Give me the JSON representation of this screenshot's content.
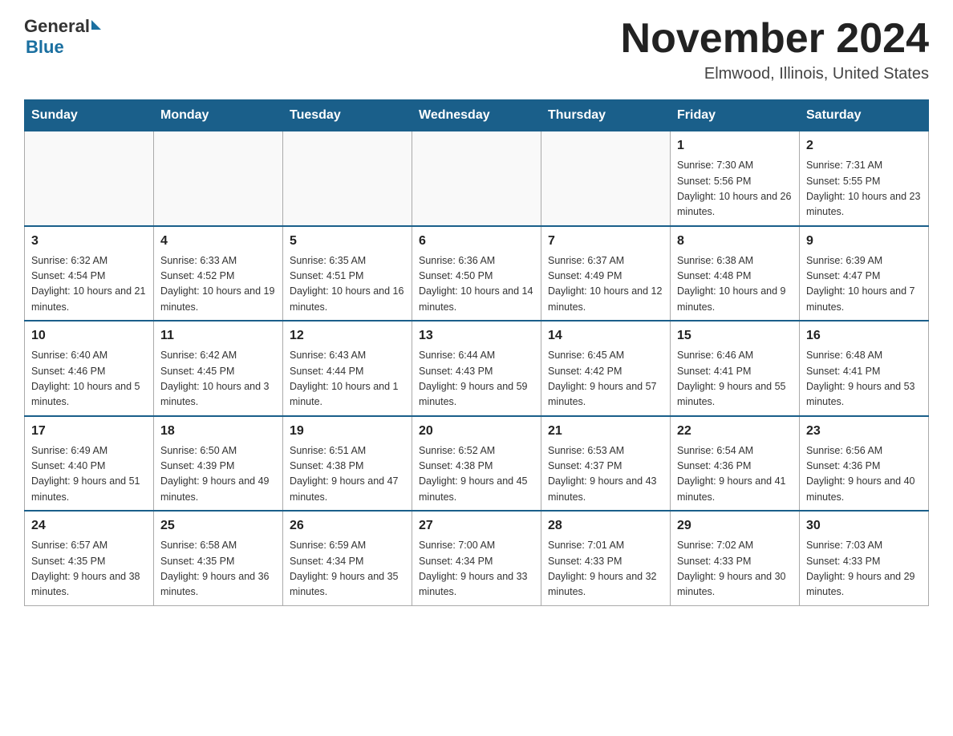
{
  "logo": {
    "general": "General",
    "blue": "Blue",
    "triangle": "▶"
  },
  "title": "November 2024",
  "subtitle": "Elmwood, Illinois, United States",
  "headers": [
    "Sunday",
    "Monday",
    "Tuesday",
    "Wednesday",
    "Thursday",
    "Friday",
    "Saturday"
  ],
  "weeks": [
    [
      {
        "day": "",
        "info": ""
      },
      {
        "day": "",
        "info": ""
      },
      {
        "day": "",
        "info": ""
      },
      {
        "day": "",
        "info": ""
      },
      {
        "day": "",
        "info": ""
      },
      {
        "day": "1",
        "info": "Sunrise: 7:30 AM\nSunset: 5:56 PM\nDaylight: 10 hours and 26 minutes."
      },
      {
        "day": "2",
        "info": "Sunrise: 7:31 AM\nSunset: 5:55 PM\nDaylight: 10 hours and 23 minutes."
      }
    ],
    [
      {
        "day": "3",
        "info": "Sunrise: 6:32 AM\nSunset: 4:54 PM\nDaylight: 10 hours and 21 minutes."
      },
      {
        "day": "4",
        "info": "Sunrise: 6:33 AM\nSunset: 4:52 PM\nDaylight: 10 hours and 19 minutes."
      },
      {
        "day": "5",
        "info": "Sunrise: 6:35 AM\nSunset: 4:51 PM\nDaylight: 10 hours and 16 minutes."
      },
      {
        "day": "6",
        "info": "Sunrise: 6:36 AM\nSunset: 4:50 PM\nDaylight: 10 hours and 14 minutes."
      },
      {
        "day": "7",
        "info": "Sunrise: 6:37 AM\nSunset: 4:49 PM\nDaylight: 10 hours and 12 minutes."
      },
      {
        "day": "8",
        "info": "Sunrise: 6:38 AM\nSunset: 4:48 PM\nDaylight: 10 hours and 9 minutes."
      },
      {
        "day": "9",
        "info": "Sunrise: 6:39 AM\nSunset: 4:47 PM\nDaylight: 10 hours and 7 minutes."
      }
    ],
    [
      {
        "day": "10",
        "info": "Sunrise: 6:40 AM\nSunset: 4:46 PM\nDaylight: 10 hours and 5 minutes."
      },
      {
        "day": "11",
        "info": "Sunrise: 6:42 AM\nSunset: 4:45 PM\nDaylight: 10 hours and 3 minutes."
      },
      {
        "day": "12",
        "info": "Sunrise: 6:43 AM\nSunset: 4:44 PM\nDaylight: 10 hours and 1 minute."
      },
      {
        "day": "13",
        "info": "Sunrise: 6:44 AM\nSunset: 4:43 PM\nDaylight: 9 hours and 59 minutes."
      },
      {
        "day": "14",
        "info": "Sunrise: 6:45 AM\nSunset: 4:42 PM\nDaylight: 9 hours and 57 minutes."
      },
      {
        "day": "15",
        "info": "Sunrise: 6:46 AM\nSunset: 4:41 PM\nDaylight: 9 hours and 55 minutes."
      },
      {
        "day": "16",
        "info": "Sunrise: 6:48 AM\nSunset: 4:41 PM\nDaylight: 9 hours and 53 minutes."
      }
    ],
    [
      {
        "day": "17",
        "info": "Sunrise: 6:49 AM\nSunset: 4:40 PM\nDaylight: 9 hours and 51 minutes."
      },
      {
        "day": "18",
        "info": "Sunrise: 6:50 AM\nSunset: 4:39 PM\nDaylight: 9 hours and 49 minutes."
      },
      {
        "day": "19",
        "info": "Sunrise: 6:51 AM\nSunset: 4:38 PM\nDaylight: 9 hours and 47 minutes."
      },
      {
        "day": "20",
        "info": "Sunrise: 6:52 AM\nSunset: 4:38 PM\nDaylight: 9 hours and 45 minutes."
      },
      {
        "day": "21",
        "info": "Sunrise: 6:53 AM\nSunset: 4:37 PM\nDaylight: 9 hours and 43 minutes."
      },
      {
        "day": "22",
        "info": "Sunrise: 6:54 AM\nSunset: 4:36 PM\nDaylight: 9 hours and 41 minutes."
      },
      {
        "day": "23",
        "info": "Sunrise: 6:56 AM\nSunset: 4:36 PM\nDaylight: 9 hours and 40 minutes."
      }
    ],
    [
      {
        "day": "24",
        "info": "Sunrise: 6:57 AM\nSunset: 4:35 PM\nDaylight: 9 hours and 38 minutes."
      },
      {
        "day": "25",
        "info": "Sunrise: 6:58 AM\nSunset: 4:35 PM\nDaylight: 9 hours and 36 minutes."
      },
      {
        "day": "26",
        "info": "Sunrise: 6:59 AM\nSunset: 4:34 PM\nDaylight: 9 hours and 35 minutes."
      },
      {
        "day": "27",
        "info": "Sunrise: 7:00 AM\nSunset: 4:34 PM\nDaylight: 9 hours and 33 minutes."
      },
      {
        "day": "28",
        "info": "Sunrise: 7:01 AM\nSunset: 4:33 PM\nDaylight: 9 hours and 32 minutes."
      },
      {
        "day": "29",
        "info": "Sunrise: 7:02 AM\nSunset: 4:33 PM\nDaylight: 9 hours and 30 minutes."
      },
      {
        "day": "30",
        "info": "Sunrise: 7:03 AM\nSunset: 4:33 PM\nDaylight: 9 hours and 29 minutes."
      }
    ]
  ]
}
